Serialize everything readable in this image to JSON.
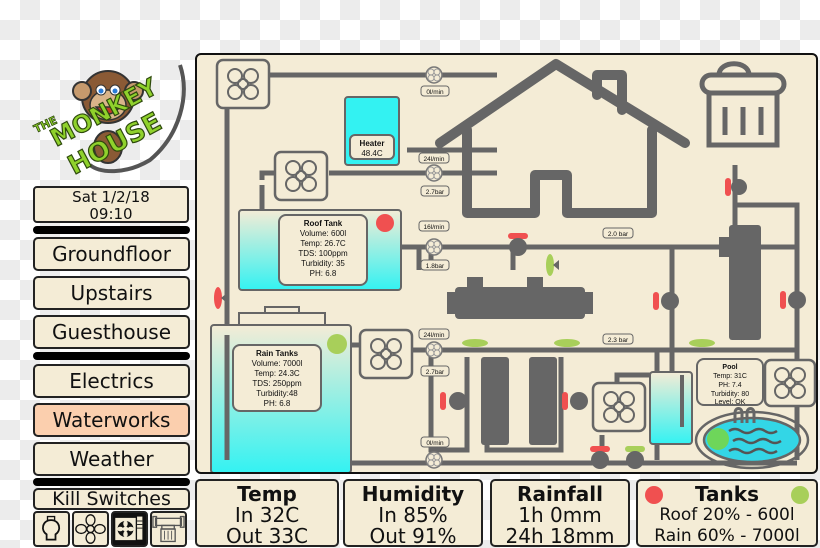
{
  "logo": {
    "line1": "THE",
    "line2": "MONKEY",
    "line3": "HOUSE"
  },
  "clock": {
    "date": "Sat 1/2/18",
    "time": "09:10"
  },
  "nav": {
    "groups": [
      {
        "items": [
          {
            "label": "Groundfloor",
            "active": false
          },
          {
            "label": "Upstairs",
            "active": false
          },
          {
            "label": "Guesthouse",
            "active": false
          }
        ]
      },
      {
        "items": [
          {
            "label": "Electrics",
            "active": false
          },
          {
            "label": "Waterworks",
            "active": true
          },
          {
            "label": "Weather",
            "active": false
          }
        ]
      }
    ]
  },
  "kill_switches": {
    "label": "Kill Switches",
    "icons": [
      "lightbulb-icon",
      "fan-icon",
      "air-conditioner-icon",
      "pump-icon"
    ]
  },
  "stats": {
    "temp": {
      "title": "Temp",
      "line1": "In 32C",
      "line2": "Out 33C"
    },
    "humidity": {
      "title": "Humidity",
      "line1": "In 85%",
      "line2": "Out 91%"
    },
    "rainfall": {
      "title": "Rainfall",
      "line1": "1h 0mm",
      "line2": "24h 18mm"
    },
    "tanks": {
      "title": "Tanks",
      "line1": "Roof 20% - 600l",
      "line2": "Rain 60% - 7000l",
      "roof_status_color": "#f05050",
      "rain_status_color": "#a8cf5a"
    }
  },
  "diagram": {
    "heater": {
      "title": "Heater",
      "value": "48.4C"
    },
    "roof_tank": {
      "title": "Roof Tank",
      "volume": "Volume: 600l",
      "temp": "Temp: 26.7C",
      "tds": "TDS: 100ppm",
      "turbidity": "Turbidity: 35",
      "ph": "PH: 6.8",
      "fill_level": 0.3,
      "status_color": "#f05050"
    },
    "rain_tanks": {
      "title": "Rain Tanks",
      "volume": "Volume: 7000l",
      "temp": "Temp: 24.3C",
      "tds": "TDS: 250ppm",
      "turbidity": "Turbidity:48",
      "ph": "PH: 6.8",
      "fill_level": 0.6,
      "status_color": "#a8cf5a"
    },
    "pool": {
      "title": "Pool",
      "temp": "Temp: 31C",
      "ph": "PH: 7.4",
      "turbidity": "Turbidity: 80",
      "level": "Level: OK"
    },
    "meters": {
      "top_flow": "0l/min",
      "heater_flow": "24l/min",
      "heater_pressure": "2.7bar",
      "roof_flow": "16l/min",
      "roof_pressure": "1.8bar",
      "rain_flow": "24l/min",
      "rain_pressure": "2.7bar",
      "bottom_flow": "0l/min",
      "main_pressure": "2.0 bar",
      "filter_pressure": "2.3 bar"
    },
    "colors": {
      "pipe": "#666666",
      "water": "#33f2f2",
      "valve_closed": "#f05050",
      "valve_open": "#a8cf5a",
      "panel_bg": "#f4ecd6"
    }
  }
}
